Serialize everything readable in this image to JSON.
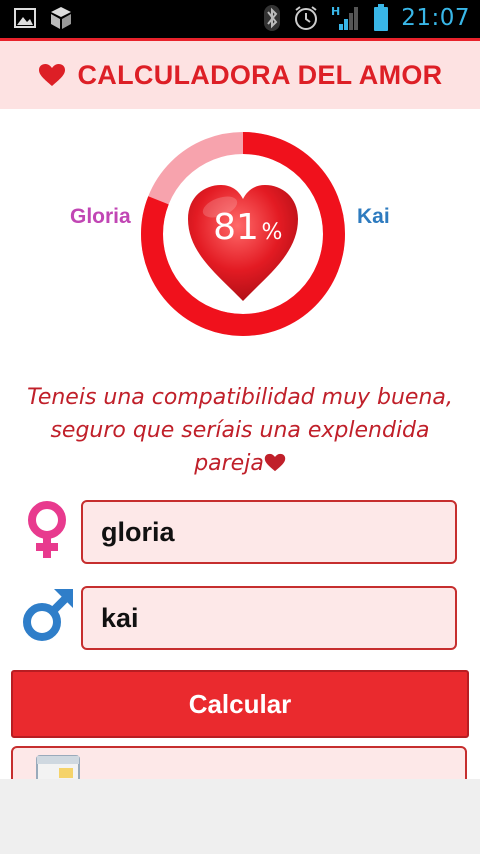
{
  "status_bar": {
    "time": "21:07",
    "icons": [
      "image-icon",
      "package-icon",
      "bluetooth-icon",
      "alarm-icon",
      "signal-icon",
      "battery-icon"
    ],
    "time_color": "#39b7e8"
  },
  "header": {
    "title": "CALCULADORA DEL AMOR",
    "accent": "#dd1f26",
    "background": "#fde2e2"
  },
  "result": {
    "percent_value": 81,
    "percent": "81",
    "percent_sign": "%",
    "name_left": "Gloria",
    "name_right": "Kai",
    "name_left_color": "#c146b4",
    "name_right_color": "#2e7bbf",
    "message": "Teneis una compatibilidad muy buena, seguro que seríais una explendida pareja"
  },
  "form": {
    "female_value": "gloria",
    "male_value": "kai",
    "calculate_label": "Calcular"
  }
}
